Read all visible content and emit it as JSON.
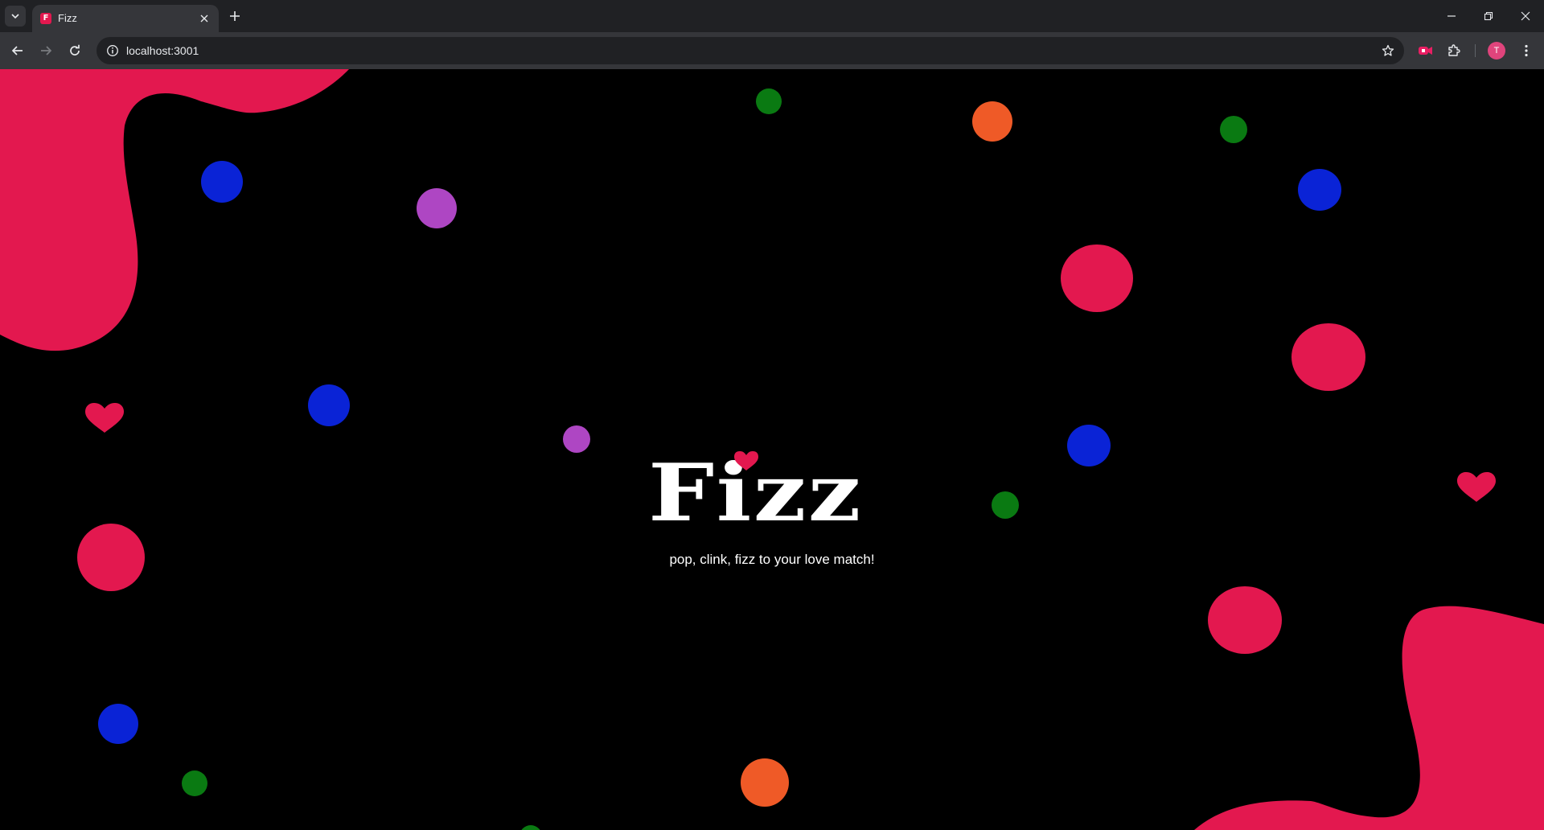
{
  "browser": {
    "tab_title": "Fizz",
    "favicon_letter": "F",
    "url": "localhost:3001",
    "avatar_letter": "T"
  },
  "page": {
    "logo": "Fizz",
    "tagline": "pop, clink, fizz to your love match!"
  },
  "colors": {
    "background": "#000000",
    "pink": "#e3184f",
    "blue": "#0a23d6",
    "purple": "#ae46c3",
    "green": "#0a7a12",
    "orange": "#ef5a27"
  }
}
